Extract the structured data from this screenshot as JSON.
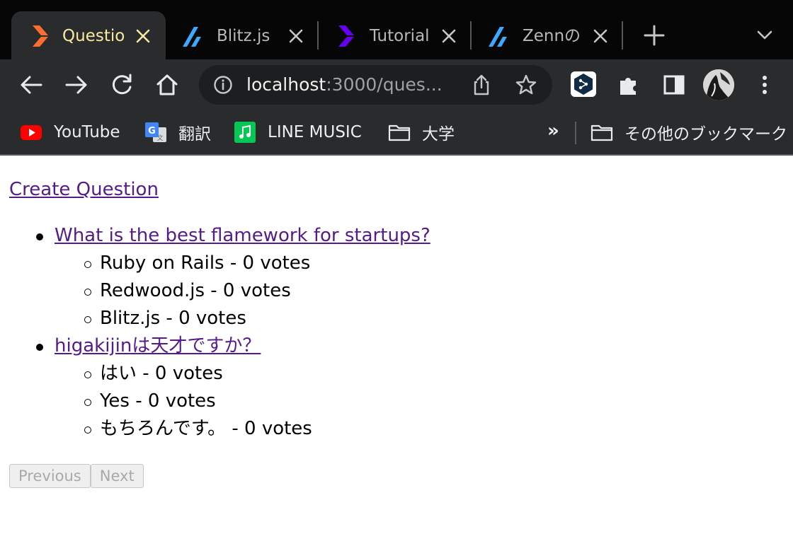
{
  "browser": {
    "tabs": [
      {
        "title": "Questio",
        "active": true,
        "favicon": "blitz-logo-icon"
      },
      {
        "title": "Blitz.js",
        "active": false,
        "favicon": "zenn-logo-icon"
      },
      {
        "title": "Tutorial",
        "active": false,
        "favicon": "blitz-logo-icon"
      },
      {
        "title": "Zennの",
        "active": false,
        "favicon": "zenn-logo-icon"
      }
    ],
    "address_bar": {
      "host": "localhost",
      "path": ":3000/ques..."
    },
    "bookmarks": [
      {
        "label": "YouTube",
        "icon": "youtube-icon"
      },
      {
        "label": "翻訳",
        "icon": "google-translate-icon"
      },
      {
        "label": "LINE MUSIC",
        "icon": "line-music-icon"
      },
      {
        "label": "大学",
        "icon": "folder-icon"
      }
    ],
    "bookmarks_overflow": "»",
    "other_bookmarks": "その他のブックマーク",
    "colors": {
      "accent_tab_title": "#f7e9a0",
      "blitz_orange": "#fc6e2f",
      "blitz_purple": "#6700eb",
      "zenn_blue": "#3ea8ff"
    }
  },
  "page": {
    "create_link": "Create Question",
    "questions": [
      {
        "text": "What is the best flamework for startups?",
        "choices": [
          "Ruby on Rails - 0 votes",
          "Redwood.js - 0 votes",
          "Blitz.js - 0 votes"
        ]
      },
      {
        "text": "higakijinは天才ですか？",
        "choices": [
          "はい - 0 votes",
          "Yes - 0 votes",
          "もちろんです。 - 0 votes"
        ]
      }
    ],
    "pagination": {
      "previous": "Previous",
      "next": "Next"
    },
    "link_color": "#551a8b"
  }
}
